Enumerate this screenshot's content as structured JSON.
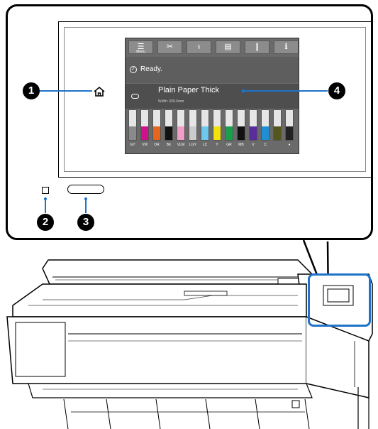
{
  "toolbar": {
    "buttons": [
      {
        "name": "menu",
        "icon": "menu-icon",
        "glyph": "☰",
        "sub": "Menu"
      },
      {
        "name": "cut",
        "icon": "scissors-icon",
        "glyph": "✂",
        "sub": ""
      },
      {
        "name": "maintenance",
        "icon": "maintenance-icon",
        "glyph": "♁",
        "sub": ""
      },
      {
        "name": "paper",
        "icon": "paper-icon",
        "glyph": "▤",
        "sub": ""
      },
      {
        "name": "feed",
        "icon": "feed-icon",
        "glyph": "❙",
        "sub": ""
      },
      {
        "name": "info",
        "icon": "info-icon",
        "glyph": "ℹ",
        "sub": ""
      }
    ]
  },
  "status": {
    "text": "Ready.",
    "icon": "check-circle-icon"
  },
  "paper": {
    "name": "Plain Paper Thick",
    "width": "Width: 609.6mm",
    "icon": "roll-paper-icon"
  },
  "inks": [
    {
      "label": "GY",
      "color": "#8a8a8a",
      "level": 0.45
    },
    {
      "label": "VM",
      "color": "#d0118a",
      "level": 0.45
    },
    {
      "label": "OR",
      "color": "#e8651e",
      "level": 0.45
    },
    {
      "label": "BK",
      "color": "#111111",
      "level": 0.45
    },
    {
      "label": "VLM",
      "color": "#f29cc8",
      "level": 0.45
    },
    {
      "label": "LGY",
      "color": "#cccccc",
      "level": 0.45
    },
    {
      "label": "LC",
      "color": "#6ec8ee",
      "level": 0.45
    },
    {
      "label": "Y",
      "color": "#f2e20c",
      "level": 0.45
    },
    {
      "label": "GR",
      "color": "#1aa04a",
      "level": 0.45
    },
    {
      "label": "MB",
      "color": "#111111",
      "level": 0.45
    },
    {
      "label": "V",
      "color": "#5a2d9c",
      "level": 0.45
    },
    {
      "label": "C",
      "color": "#1e8fd6",
      "level": 0.45
    },
    {
      "label": "",
      "color": "#55551e",
      "level": 0.45
    },
    {
      "label": "♦",
      "color": "#222222",
      "level": 0.45
    }
  ],
  "callouts": [
    "1",
    "2",
    "3",
    "4"
  ],
  "colors": {
    "highlight": "#1e73c8"
  }
}
